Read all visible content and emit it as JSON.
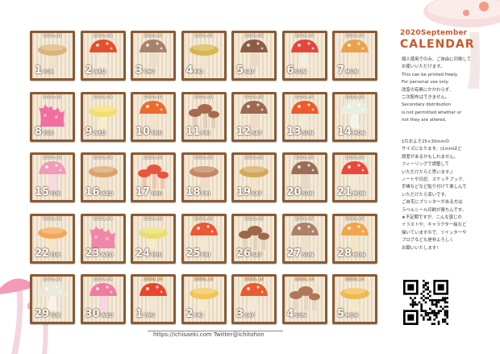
{
  "header": {
    "title_top": "2020September",
    "title_main": "CALENDAR"
  },
  "cards": [
    {
      "year": "2020.09",
      "day": "1",
      "weekday": "TUE",
      "cap": "#d9b47a",
      "stem": "#efe2c4",
      "kind": "flat"
    },
    {
      "year": "2020.09",
      "day": "2",
      "weekday": "WED",
      "cap": "#e3502e",
      "stem": "#f2ead8",
      "kind": "round"
    },
    {
      "year": "2020.09",
      "day": "3",
      "weekday": "THU",
      "cap": "#a8826a",
      "stem": "#eadfce",
      "kind": "round"
    },
    {
      "year": "2020.09",
      "day": "4",
      "weekday": "FRI",
      "cap": "#d8b54e",
      "stem": "#f0e6cc",
      "kind": "flat"
    },
    {
      "year": "2020.09",
      "day": "5",
      "weekday": "SAT",
      "cap": "#8e5b45",
      "stem": "#e8dcc6",
      "kind": "round"
    },
    {
      "year": "2020.09",
      "day": "6",
      "weekday": "SUN",
      "cap": "#e3463a",
      "stem": "#f3ece0",
      "kind": "round"
    },
    {
      "year": "2020.09",
      "day": "7",
      "weekday": "MON",
      "cap": "#e9a24a",
      "stem": "#f4e8cc",
      "kind": "round"
    },
    {
      "year": "2020.09",
      "day": "8",
      "weekday": "TUE",
      "cap": "#f06fa0",
      "stem": "#f6c7da",
      "kind": "coral"
    },
    {
      "year": "2020.09",
      "day": "9",
      "weekday": "WED",
      "cap": "#f3de6a",
      "stem": "#f6efc8",
      "kind": "flat"
    },
    {
      "year": "2020.09",
      "day": "10",
      "weekday": "THU",
      "cap": "#ec6a2e",
      "stem": "#f2e2c8",
      "kind": "round"
    },
    {
      "year": "2020.09",
      "day": "11",
      "weekday": "FRI",
      "cap": "#a86a4e",
      "stem": "#e3cfb8",
      "kind": "cluster"
    },
    {
      "year": "2020.09",
      "day": "12",
      "weekday": "SAT",
      "cap": "#9a6a52",
      "stem": "#ecdcc6",
      "kind": "round"
    },
    {
      "year": "2020.09",
      "day": "13",
      "weekday": "SUN",
      "cap": "#ef5a2a",
      "stem": "#f2ead6",
      "kind": "round"
    },
    {
      "year": "2020.09",
      "day": "14",
      "weekday": "MON",
      "cap": "#e8efe2",
      "stem": "#f4f4ec",
      "kind": "round"
    },
    {
      "year": "2020.09",
      "day": "15",
      "weekday": "TUE",
      "cap": "#f29ab8",
      "stem": "#f8d9e4",
      "kind": "round"
    },
    {
      "year": "2020.09",
      "day": "16",
      "weekday": "WED",
      "cap": "#d9a36a",
      "stem": "#f1e3c9",
      "kind": "flat"
    },
    {
      "year": "2020.09",
      "day": "17",
      "weekday": "THU",
      "cap": "#e9553a",
      "stem": "#f0c3b0",
      "kind": "cluster"
    },
    {
      "year": "2020.09",
      "day": "18",
      "weekday": "FRI",
      "cap": "#c58664",
      "stem": "#eedccb",
      "kind": "flat"
    },
    {
      "year": "2020.09",
      "day": "19",
      "weekday": "SAT",
      "cap": "#d4a85a",
      "stem": "#f0e4c6",
      "kind": "flat"
    },
    {
      "year": "2020.09",
      "day": "20",
      "weekday": "SUN",
      "cap": "#9a6e56",
      "stem": "#e7d8c4",
      "kind": "round"
    },
    {
      "year": "2020.09",
      "day": "21",
      "weekday": "MON",
      "cap": "#e8493a",
      "stem": "#f3e7d6",
      "kind": "round"
    },
    {
      "year": "2020.09",
      "day": "22",
      "weekday": "TUE",
      "cap": "#f3a654",
      "stem": "#f6e6c4",
      "kind": "flat"
    },
    {
      "year": "2020.09",
      "day": "23",
      "weekday": "WED",
      "cap": "#f087a8",
      "stem": "#f7d0dc",
      "kind": "coral"
    },
    {
      "year": "2020.09",
      "day": "24",
      "weekday": "THU",
      "cap": "#ebdd6a",
      "stem": "#f4edc6",
      "kind": "flat"
    },
    {
      "year": "2020.09",
      "day": "25",
      "weekday": "FRI",
      "cap": "#e95a36",
      "stem": "#f3e6d4",
      "kind": "round"
    },
    {
      "year": "2020.09",
      "day": "26",
      "weekday": "SAT",
      "cap": "#9e6848",
      "stem": "#e4d2bc",
      "kind": "cluster"
    },
    {
      "year": "2020.09",
      "day": "27",
      "weekday": "SUN",
      "cap": "#ad8068",
      "stem": "#ecdfcc",
      "kind": "round"
    },
    {
      "year": "2020.09",
      "day": "28",
      "weekday": "MON",
      "cap": "#f0a64a",
      "stem": "#f5e4c2",
      "kind": "round"
    },
    {
      "year": "2020.09",
      "day": "29",
      "weekday": "TUE",
      "cap": "#ece8da",
      "stem": "#f6f3ea",
      "kind": "round"
    },
    {
      "year": "2020.09",
      "day": "30",
      "weekday": "WED",
      "cap": "#f07ca0",
      "stem": "#f8d5e0",
      "kind": "round"
    },
    {
      "year": "2020.10",
      "day": "1",
      "weekday": "THU",
      "cap": "#e8462e",
      "stem": "#f2e5d2",
      "kind": "round"
    },
    {
      "year": "2020.10",
      "day": "2",
      "weekday": "FRI",
      "cap": "#f1c458",
      "stem": "#f4eacc",
      "kind": "flat"
    },
    {
      "year": "2020.10",
      "day": "3",
      "weekday": "SAT",
      "cap": "#eb5a30",
      "stem": "#f3e8d6",
      "kind": "round"
    },
    {
      "year": "2020.10",
      "day": "4",
      "weekday": "SUN",
      "cap": "#b07858",
      "stem": "#e6d6c2",
      "kind": "cluster"
    },
    {
      "year": "2020.10",
      "day": "5",
      "weekday": "MON",
      "cap": "#f0ba4c",
      "stem": "#f5e8c8",
      "kind": "flat"
    }
  ],
  "notes": {
    "block1": "個人使用でのみ、ご自由に印刷して\nお使いいただけます。\nThis can be printed freely.\nFor personal use only.\n改変の有無にかかわらず、\n二次配布はできません。\nSecondary distribution\nis not permitted whether or\nnot they are altered.",
    "block2": "1片およそ25×30mmの\nサイズになります。(1mmほど\n誤差があるかもしれません。\nフィーリングで調整して\nいただけたらと思います。)\nノートや日記、スケッチブック、\n手帳などなど貼り付けて楽しんで\nいただけたら幸いです。\nご自宅にプリンターがある方は\nラベルシール印刷が楽ちんです。\n★不定期ですが、こんな感じの\nイラストや、キャラクター絵など\n描いていますので、ツイッターや\nブログなども是非よろしく\nお願いいたします!"
  },
  "footer": {
    "text": "https://ichisaeki.com  Twitter@ichitohon"
  },
  "qr": {
    "label": "qr-code"
  }
}
